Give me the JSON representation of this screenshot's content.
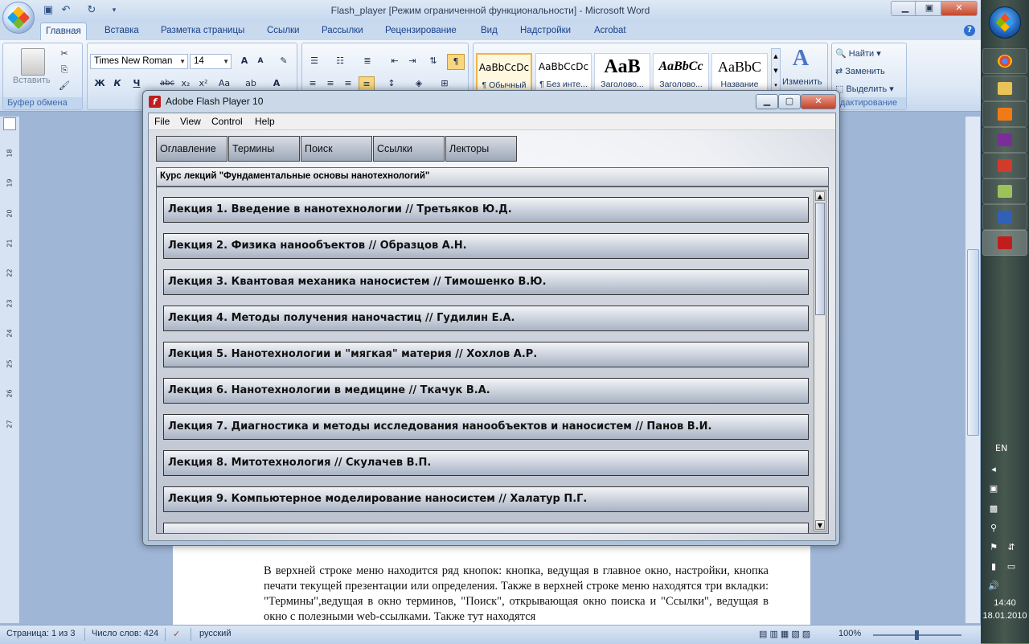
{
  "word": {
    "title": "Flash_player [Режим ограниченной функциональности] - Microsoft Word",
    "tabs": [
      "Главная",
      "Вставка",
      "Разметка страницы",
      "Ссылки",
      "Рассылки",
      "Рецензирование",
      "Вид",
      "Надстройки",
      "Acrobat"
    ],
    "active_tab": "Главная",
    "clipboard": {
      "paste_label": "Вставить",
      "group_label": "Буфер обмена"
    },
    "font": {
      "name": "Times New Roman",
      "size": "14"
    },
    "styles": [
      {
        "sample": "AaBbCcDc",
        "name": "¶ Обычный"
      },
      {
        "sample": "AaBbCcDc",
        "name": "¶ Без инте..."
      },
      {
        "sample": "AaB",
        "name": "Заголово..."
      },
      {
        "sample": "AaBbCc",
        "name": "Заголово..."
      },
      {
        "sample": "AaBbC",
        "name": "Название"
      }
    ],
    "change_styles": "Изменить",
    "editing": {
      "find": "Найти",
      "replace": "Заменить",
      "select": "Выделить",
      "group_label": "дактирование"
    },
    "doc_text": "В верхней строке меню находится ряд кнопок: кнопка, ведущая в главное окно, настройки, кнопка печати текущей презентации или определения. Также в верхней строке меню находятся три вкладки: \"Термины\",ведущая в окно терминов, \"Поиск\", открывающая окно поиска и \"Ссылки\", ведущая в окно с полезными web-ссылками. Также тут находятся",
    "ruler_numbers": [
      "18",
      "19",
      "20",
      "21",
      "22",
      "23",
      "24",
      "25",
      "26",
      "27"
    ],
    "status": {
      "page": "Страница: 1 из 3",
      "words": "Число слов: 424",
      "language": "русский",
      "zoom": "100%"
    }
  },
  "flash": {
    "title": "Adobe Flash Player 10",
    "menu": [
      "File",
      "View",
      "Control",
      "Help"
    ],
    "nav_tabs": [
      "Оглавление",
      "Термины",
      "Поиск",
      "Ссылки",
      "Лекторы"
    ],
    "course_title": "Курс лекций \"Фундаментальные основы нанотехнологий\"",
    "lectures": [
      "Лекция 1. Введение в нанотехнологии // Третьяков Ю.Д.",
      "Лекция 2. Физика нанообъектов // Образцов А.Н.",
      "Лекция 3. Квантовая механика наносистем // Тимошенко В.Ю.",
      "Лекция 4. Методы получения наночастиц // Гудилин Е.А.",
      "Лекция 5. Нанотехнологии и \"мягкая\" материя // Хохлов А.Р.",
      "Лекция 6. Нанотехнологии в медицине // Ткачук В.А.",
      "Лекция 7. Диагностика и методы исследования нанообъектов и наносистем // Панов В.И.",
      "Лекция 8. Митотехнология // Скулачев В.П.",
      "Лекция 9. Компьютерное моделирование наносистем // Халатур П.Г."
    ]
  },
  "taskbar": {
    "language": "EN",
    "time": "14:40",
    "date": "18.01.2010"
  }
}
